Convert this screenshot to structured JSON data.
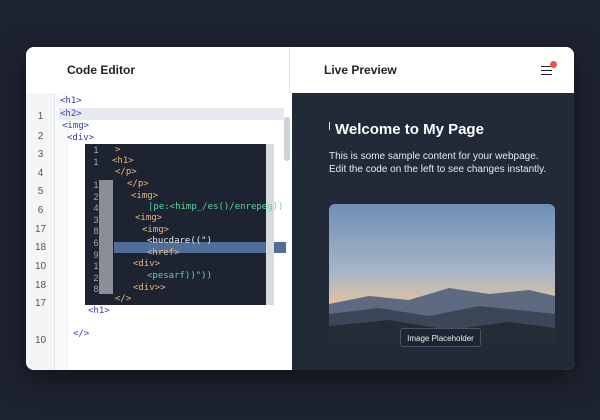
{
  "editor": {
    "title": "Code Editor",
    "gutter_numbers": [
      "1",
      "2",
      "3",
      "4",
      "5",
      "6",
      "17",
      "18",
      "10",
      "18",
      "17",
      "10"
    ],
    "outer_code": [
      "<h1>",
      "<h2>",
      "<img>",
      "<div>"
    ],
    "inner_numbers": [
      "1",
      "1",
      "",
      "1",
      "2",
      "4",
      "3",
      "8",
      "6",
      "9",
      "1",
      "2",
      "8"
    ],
    "inner_code": [
      ">",
      "<h1>",
      "</p>",
      "</p>",
      "<img>",
      "|pe:<himp_/es()/enrepeg))",
      "<img>",
      "<img>",
      "<bucdare((\")",
      "<href>",
      "<div>",
      "<pesarf))\"))",
      "<div>>",
      "</>"
    ],
    "trailing_code": [
      "<h1>",
      "</>"
    ]
  },
  "preview": {
    "title": "Live Preview",
    "menu_icon": "hamburger-icon",
    "notification_color": "#e8554a",
    "heading": "Welcome to My Page",
    "paragraph_lines": [
      "This is some sample content for your webpage.",
      "Edit the code on the left to see changes instantly."
    ],
    "image_caption": "Image Placeholder"
  }
}
